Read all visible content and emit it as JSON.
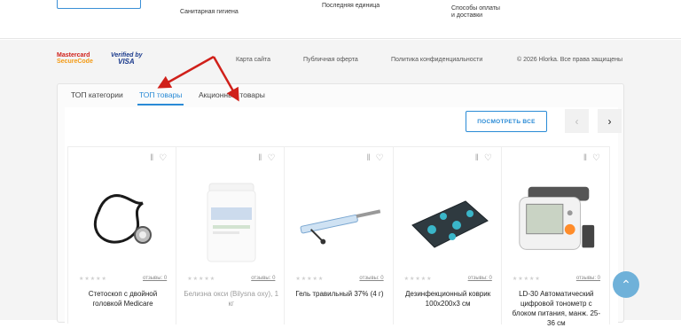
{
  "top": {
    "links": [
      "Санитарная гигиена",
      "Последняя единица",
      "Способы оплаты и доставки"
    ]
  },
  "footer": {
    "mastercard_l1": "Mastercard",
    "mastercard_l2": "SecureCode",
    "visa_l1": "Verified by",
    "visa_l2": "VISA",
    "links": [
      "Карта сайта",
      "Публичная оферта",
      "Политика конфиденциальности"
    ],
    "copyright": "© 2026 Hlorka. Все права защищены"
  },
  "tabs": [
    {
      "label": "ТОП категории",
      "active": false
    },
    {
      "label": "ТОП товары",
      "active": true
    },
    {
      "label": "Акционные товары",
      "active": false
    }
  ],
  "show_all": "ПОСМОТРЕТЬ ВСЕ",
  "products": [
    {
      "title": "Стетоскоп с двойной головкой Medicare",
      "reviews": "отзывы: 0",
      "faded": false
    },
    {
      "title": "Белизна окси (Bilysna oxy), 1 кг",
      "reviews": "отзывы: 0",
      "faded": true
    },
    {
      "title": "Гель травильный 37% (4 г)",
      "reviews": "отзывы: 0",
      "faded": false
    },
    {
      "title": "Дезинфекционный коврик 100х200х3 см",
      "reviews": "отзывы: 0",
      "faded": false
    },
    {
      "title": "LD-30 Автоматический цифровой тонометр с блоком питания, манж. 25-36 см",
      "reviews": "отзывы: 0",
      "faded": false
    }
  ],
  "colors": {
    "accent": "#2a8bd6",
    "arrow": "#d0201a",
    "scroll_top": "#6fb1d9"
  },
  "icons": [
    "compare-icon",
    "heart-icon",
    "chevron-left-icon",
    "chevron-right-icon",
    "arrow-up-icon"
  ]
}
